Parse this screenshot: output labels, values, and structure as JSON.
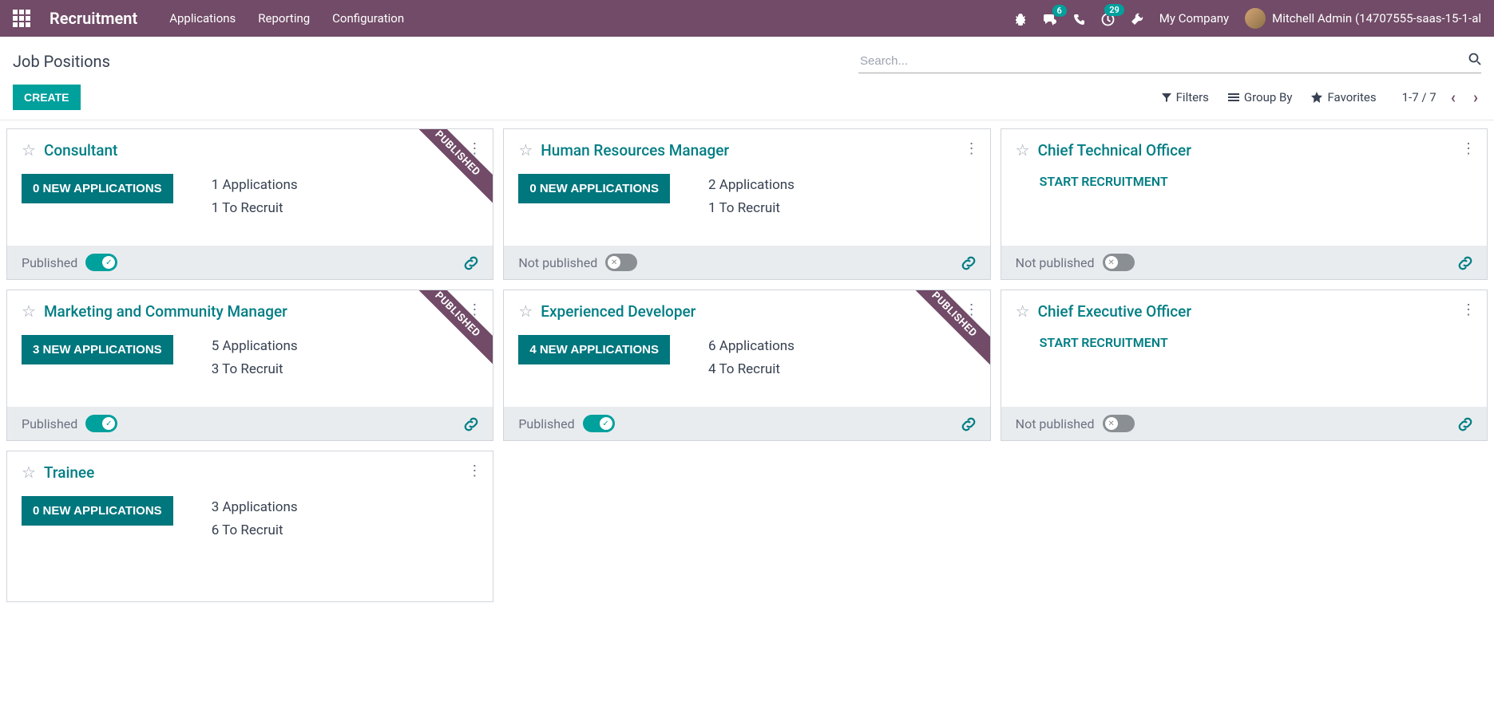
{
  "navbar": {
    "app_title": "Recruitment",
    "links": [
      "Applications",
      "Reporting",
      "Configuration"
    ],
    "messages_badge": "6",
    "activities_badge": "29",
    "company": "My Company",
    "user": "Mitchell Admin (14707555-saas-15-1-al"
  },
  "control": {
    "breadcrumb": "Job Positions",
    "search_placeholder": "Search...",
    "create": "CREATE",
    "filters": "Filters",
    "group_by": "Group By",
    "favorites": "Favorites",
    "pager": "1-7 / 7"
  },
  "labels": {
    "published_ribbon": "PUBLISHED",
    "published": "Published",
    "not_published": "Not published",
    "start_recruitment": "START RECRUITMENT"
  },
  "cards": [
    {
      "title": "Consultant",
      "new_apps": "0 NEW APPLICATIONS",
      "line1": "1 Applications",
      "line2": "1 To Recruit",
      "published": true,
      "ribbon": true,
      "has_stats": true
    },
    {
      "title": "Human Resources Manager",
      "new_apps": "0 NEW APPLICATIONS",
      "line1": "2 Applications",
      "line2": "1 To Recruit",
      "published": false,
      "ribbon": false,
      "has_stats": true
    },
    {
      "title": "Chief Technical Officer",
      "published": false,
      "ribbon": false,
      "has_stats": false
    },
    {
      "title": "Marketing and Community Manager",
      "new_apps": "3 NEW APPLICATIONS",
      "line1": "5 Applications",
      "line2": "3 To Recruit",
      "published": true,
      "ribbon": true,
      "has_stats": true
    },
    {
      "title": "Experienced Developer",
      "new_apps": "4 NEW APPLICATIONS",
      "line1": "6 Applications",
      "line2": "4 To Recruit",
      "published": true,
      "ribbon": true,
      "has_stats": true
    },
    {
      "title": "Chief Executive Officer",
      "published": false,
      "ribbon": false,
      "has_stats": false
    },
    {
      "title": "Trainee",
      "new_apps": "0 NEW APPLICATIONS",
      "line1": "3 Applications",
      "line2": "6 To Recruit",
      "published": false,
      "ribbon": false,
      "has_stats": true,
      "no_footer": true
    }
  ]
}
